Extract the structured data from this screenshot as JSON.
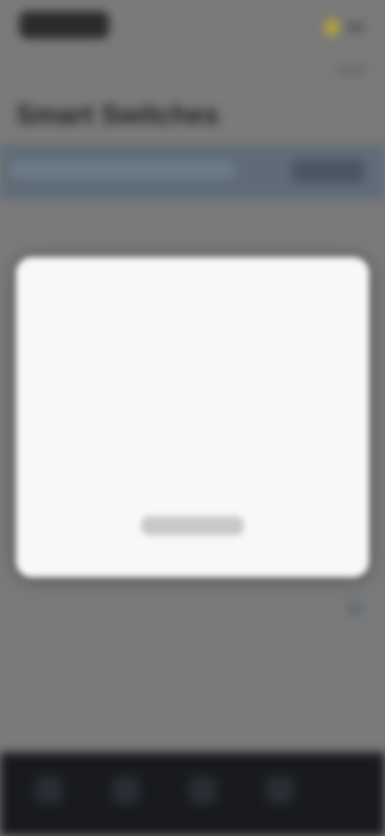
{
  "status": {
    "time": "",
    "right_icons": [
      "signal-icon",
      "battery-icon"
    ]
  },
  "page": {
    "title": "Smart Switches",
    "section_label": "",
    "bottom_row_label": ""
  },
  "banner": {
    "message": "",
    "action_label": ""
  },
  "modal": {
    "title": "",
    "subtitle": "",
    "paragraph_1": "",
    "paragraph_2": "",
    "button_label": ""
  },
  "navbar": {
    "items": [
      {
        "icon": "back-icon"
      },
      {
        "icon": "home-icon"
      },
      {
        "icon": "recent-apps-icon"
      },
      {
        "icon": "menu-icon"
      }
    ]
  },
  "colors": {
    "background": "#7a7a7a",
    "banner": "#5f6c78",
    "modal": "#f8f8f8",
    "navbar": "#181a1e"
  }
}
